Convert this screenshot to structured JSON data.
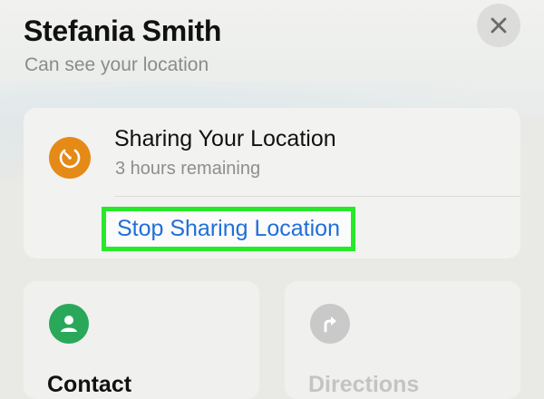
{
  "header": {
    "title": "Stefania Smith",
    "subtitle": "Can see your location"
  },
  "sharing": {
    "title": "Sharing Your Location",
    "remaining": "3 hours remaining",
    "stop_label": "Stop Sharing Location"
  },
  "actions": [
    {
      "label": "Contact",
      "icon": "person-icon",
      "color": "#2aa85a",
      "enabled": true
    },
    {
      "label": "Directions",
      "icon": "directions-arrow-icon",
      "color": "#c9c9c9",
      "enabled": false
    }
  ],
  "colors": {
    "accent_link": "#1f6fd8",
    "highlight": "#28e82a",
    "timer": "#e58a16"
  }
}
